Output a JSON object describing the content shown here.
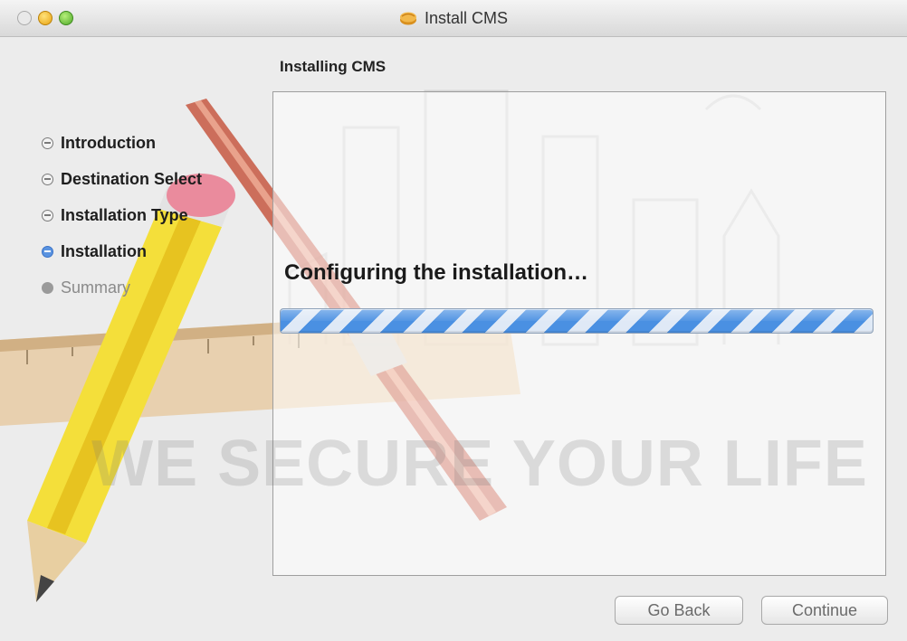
{
  "window": {
    "title": "Install CMS",
    "section_title": "Installing CMS"
  },
  "steps": [
    {
      "label": "Introduction",
      "state": "done"
    },
    {
      "label": "Destination Select",
      "state": "done"
    },
    {
      "label": "Installation Type",
      "state": "done"
    },
    {
      "label": "Installation",
      "state": "current"
    },
    {
      "label": "Summary",
      "state": "future"
    }
  ],
  "main": {
    "status": "Configuring the installation…",
    "watermark": "WE SECURE YOUR LIFE"
  },
  "buttons": {
    "back": "Go Back",
    "continue": "Continue"
  },
  "icons": {
    "title_icon": "package-icon",
    "background_art": "pencil-ruler-illustration"
  },
  "colors": {
    "progress_blue": "#4a90e2",
    "current_step": "#5a93e0"
  }
}
